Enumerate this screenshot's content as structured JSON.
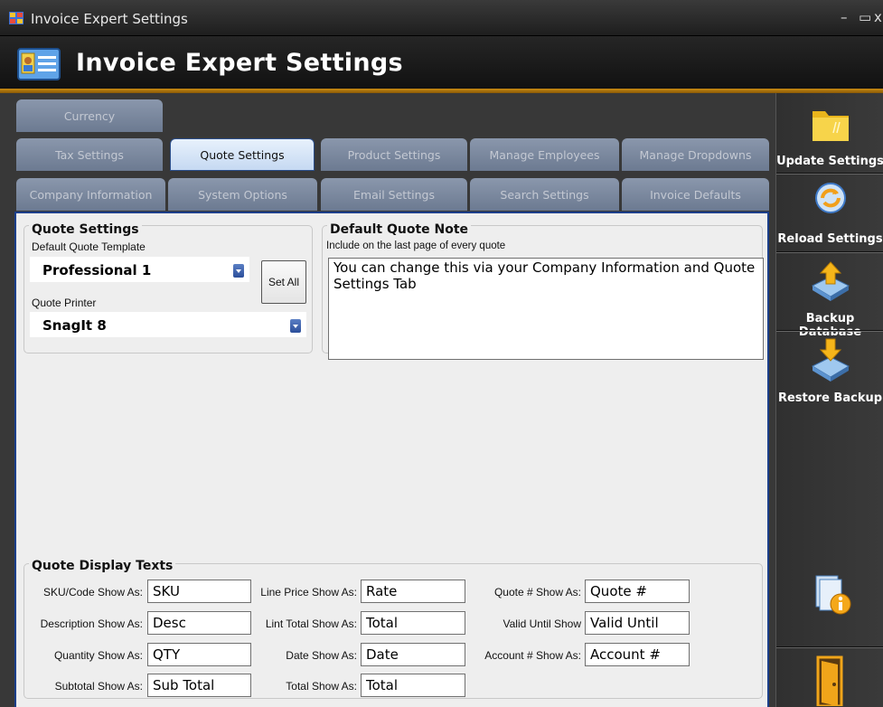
{
  "window": {
    "title": "Invoice Expert Settings",
    "minimize": "–",
    "maximize": "▭",
    "close": "x"
  },
  "header": {
    "title": "Invoice Expert Settings"
  },
  "tabs": {
    "row1": [
      "Currency"
    ],
    "row2": [
      "Tax Settings",
      "Quote Settings",
      "Product Settings",
      "Manage Employees",
      "Manage Dropdowns"
    ],
    "row3": [
      "Company Information",
      "System Options",
      "Email Settings",
      "Search Settings",
      "Invoice Defaults"
    ],
    "active": "Quote Settings"
  },
  "quote_settings": {
    "title": "Quote Settings",
    "template_label": "Default Quote Template",
    "template_value": "Professional 1",
    "set_all": "Set All",
    "printer_label": "Quote Printer",
    "printer_value": "SnagIt 8"
  },
  "default_note": {
    "title": "Default Quote Note",
    "hint": "Include on the last page of every quote",
    "text": "You can change this via your Company Information and Quote Settings Tab"
  },
  "display_texts": {
    "title": "Quote Display Texts",
    "fields": [
      {
        "label": "SKU/Code Show As:",
        "value": "SKU"
      },
      {
        "label": "Description Show As:",
        "value": "Desc"
      },
      {
        "label": "Quantity Show As:",
        "value": "QTY"
      },
      {
        "label": "Subtotal Show As:",
        "value": "Sub Total"
      },
      {
        "label": "Line Price Show As:",
        "value": "Rate"
      },
      {
        "label": "Lint Total Show As:",
        "value": "Total"
      },
      {
        "label": "Date Show As:",
        "value": "Date"
      },
      {
        "label": "Total Show As:",
        "value": "Total"
      },
      {
        "label": "Quote # Show As:",
        "value": "Quote #"
      },
      {
        "label": "Valid Until Show",
        "value": "Valid Until"
      },
      {
        "label": "Account # Show As:",
        "value": "Account #"
      }
    ]
  },
  "sidebar": {
    "update": "Update Settings",
    "reload": "Reload Settings",
    "backup": "Backup Database",
    "restore": "Restore Backup"
  },
  "colors": {
    "accent_orange": "#c98a12",
    "tab_active_border": "#1c3f8a",
    "tab_inactive": "#7a88a0"
  }
}
